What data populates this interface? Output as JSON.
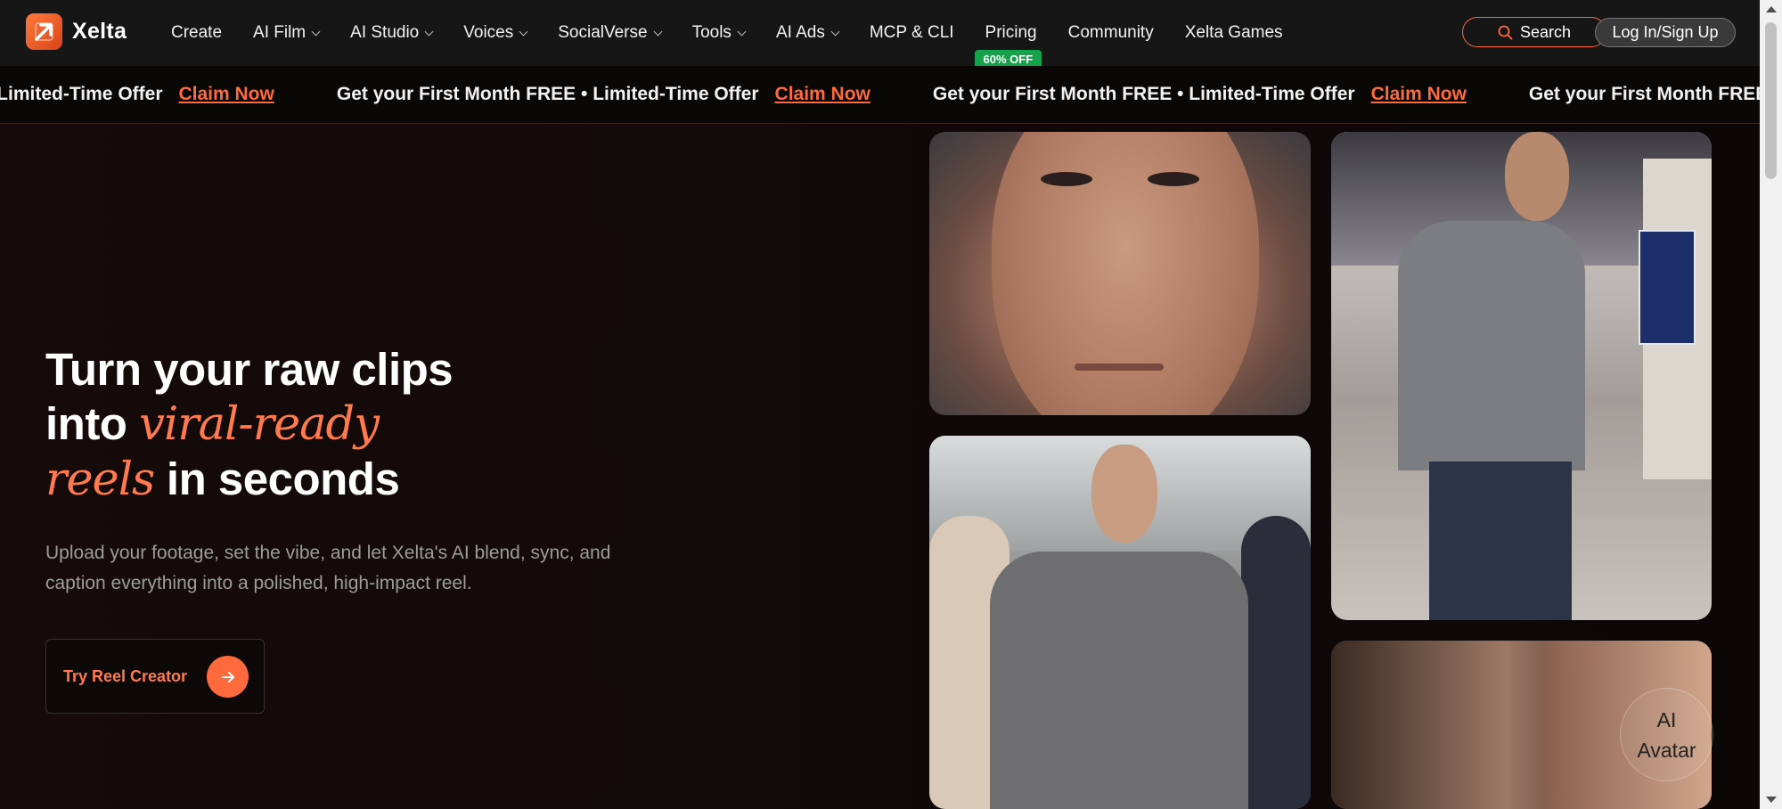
{
  "brand": {
    "name": "Xelta"
  },
  "nav": {
    "items": [
      {
        "label": "Create",
        "dropdown": false
      },
      {
        "label": "AI Film",
        "dropdown": true
      },
      {
        "label": "AI Studio",
        "dropdown": true
      },
      {
        "label": "Voices",
        "dropdown": true
      },
      {
        "label": "SocialVerse",
        "dropdown": true
      },
      {
        "label": "Tools",
        "dropdown": true
      },
      {
        "label": "AI Ads",
        "dropdown": true
      },
      {
        "label": "MCP & CLI",
        "dropdown": false
      },
      {
        "label": "Pricing",
        "dropdown": false,
        "badge": "60% OFF"
      },
      {
        "label": "Community",
        "dropdown": false
      },
      {
        "label": "Xelta Games",
        "dropdown": false
      }
    ],
    "search_label": "Search",
    "login_label": "Log In/Sign Up"
  },
  "promo": {
    "first_fragment": "• Limited-Time Offer",
    "message": "Get your First Month FREE • Limited-Time Offer",
    "last_fragment": "Get your First Month FREE",
    "link_label": "Claim Now"
  },
  "hero": {
    "headline_line1": "Turn your raw clips",
    "headline_into": "into",
    "headline_accent1": "viral-ready",
    "headline_accent2": "reels",
    "headline_end": "in seconds",
    "subtitle": "Upload your footage, set the vibe, and let Xelta's AI blend, sync, and caption everything into a polished, high-impact reel.",
    "cta_label": "Try Reel Creator"
  },
  "floating": {
    "line1": "AI",
    "line2": "Avatar"
  },
  "colors": {
    "accent": "#ff6a3d",
    "badge": "#14a34a",
    "background": "#0c0808"
  }
}
